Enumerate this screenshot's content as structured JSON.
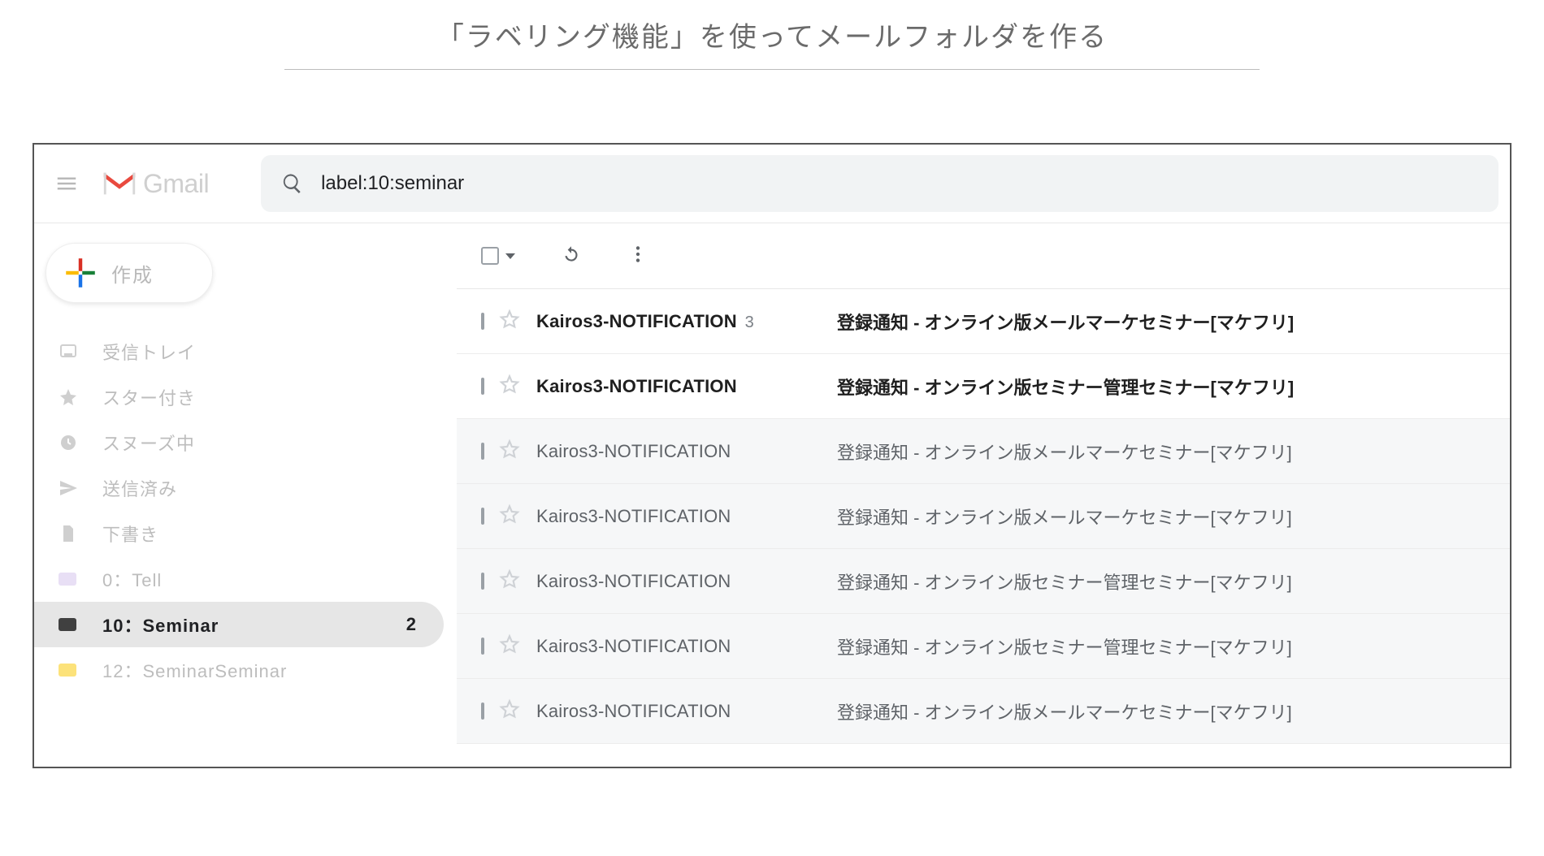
{
  "page": {
    "title": "「ラベリング機能」を使ってメールフォルダを作る"
  },
  "header": {
    "brand": "Gmail",
    "search_query": "label:10:seminar"
  },
  "sidebar": {
    "compose_label": "作成",
    "items": [
      {
        "icon": "inbox",
        "label": "受信トレイ"
      },
      {
        "icon": "star",
        "label": "スター付き"
      },
      {
        "icon": "clock",
        "label": "スヌーズ中"
      },
      {
        "icon": "send",
        "label": "送信済み"
      },
      {
        "icon": "file",
        "label": "下書き"
      },
      {
        "icon": "tag",
        "label": "0：Tell",
        "swatch": "#e8dff5"
      },
      {
        "icon": "tag",
        "label": "10：Seminar",
        "swatch": "#404040",
        "selected": true,
        "count": "2"
      },
      {
        "icon": "tag",
        "label": "12：SeminarSeminar",
        "swatch": "#fce27a"
      }
    ]
  },
  "mail": {
    "rows": [
      {
        "unread": true,
        "sender": "Kairos3-NOTIFICATION",
        "thread_count": "3",
        "subject": "登録通知 - オンライン版メールマーケセミナー[マケフリ]"
      },
      {
        "unread": true,
        "sender": "Kairos3-NOTIFICATION",
        "subject": "登録通知 - オンライン版セミナー管理セミナー[マケフリ]"
      },
      {
        "unread": false,
        "sender": "Kairos3-NOTIFICATION",
        "subject": "登録通知 - オンライン版メールマーケセミナー[マケフリ]"
      },
      {
        "unread": false,
        "sender": "Kairos3-NOTIFICATION",
        "subject": "登録通知 - オンライン版メールマーケセミナー[マケフリ]"
      },
      {
        "unread": false,
        "sender": "Kairos3-NOTIFICATION",
        "subject": "登録通知 - オンライン版セミナー管理セミナー[マケフリ]"
      },
      {
        "unread": false,
        "sender": "Kairos3-NOTIFICATION",
        "subject": "登録通知 - オンライン版セミナー管理セミナー[マケフリ]"
      },
      {
        "unread": false,
        "sender": "Kairos3-NOTIFICATION",
        "subject": "登録通知 - オンライン版メールマーケセミナー[マケフリ]"
      }
    ]
  }
}
